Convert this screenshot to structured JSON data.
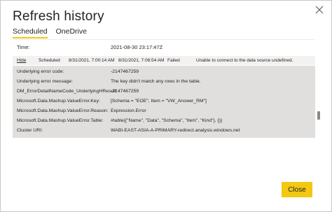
{
  "dialog": {
    "title": "Refresh history",
    "tabs": [
      {
        "label": "Scheduled",
        "active": true
      },
      {
        "label": "OneDrive",
        "active": false
      }
    ],
    "close_icon": "close-icon"
  },
  "time": {
    "label": "Time:",
    "value": "2021-08-30 23:17:47Z"
  },
  "history_row": {
    "toggle": "Hide",
    "type": "Scheduled",
    "start": "8/31/2021, 7:00:14 AM",
    "end": "8/31/2021, 7:06:54 AM",
    "status": "Failed",
    "message": "Unable to connect to the data source undefined."
  },
  "details": [
    {
      "key": "Underlying error code:",
      "value": "-2147467259"
    },
    {
      "key": "Underlying error message:",
      "value": "The key didn't match any rows in the table."
    },
    {
      "key": "DM_ErrorDetailNameCode_UnderlyingHResult:",
      "value": "-2147467259"
    },
    {
      "key": "Microsoft.Data.Mashup.ValueError.Key:",
      "value": "[Schema = \"EOE\", Item = \"VW_Answer_RM\"]"
    },
    {
      "key": "Microsoft.Data.Mashup.ValueError.Reason:",
      "value": "Expression.Error"
    },
    {
      "key": "Microsoft.Data.Mashup.ValueError.Table:",
      "value": "#table({\"Name\", \"Data\", \"Schema\", \"Item\", \"Kind\"}, {})"
    },
    {
      "key": "Cluster URI:",
      "value": "WABI-EAST-ASIA-A-PRIMARY-redirect.analysis.windows.net"
    }
  ],
  "footer": {
    "close_label": "Close"
  },
  "colors": {
    "accent": "#f2c811",
    "detail_bg": "#e1dfdd"
  }
}
